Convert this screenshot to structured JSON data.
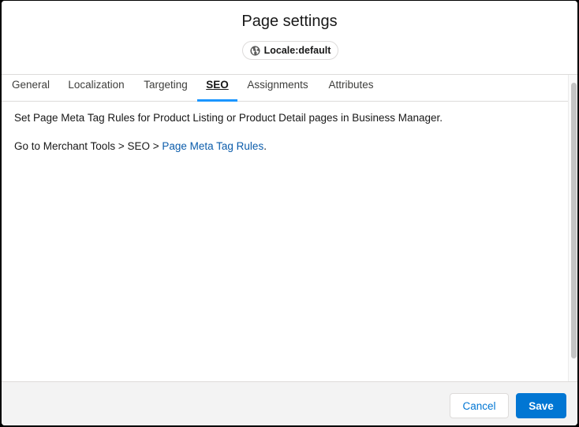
{
  "modal": {
    "title": "Page settings",
    "locale": {
      "icon": "globe-icon",
      "label": "Locale:default"
    }
  },
  "tabs": [
    {
      "label": "General",
      "active": false
    },
    {
      "label": "Localization",
      "active": false
    },
    {
      "label": "Targeting",
      "active": false
    },
    {
      "label": "SEO",
      "active": true
    },
    {
      "label": "Assignments",
      "active": false
    },
    {
      "label": "Attributes",
      "active": false
    }
  ],
  "content": {
    "line1": "Set Page Meta Tag Rules for Product Listing or Product Detail pages in Business Manager.",
    "line2_prefix": "Go to Merchant Tools > SEO > ",
    "line2_link": "Page Meta Tag Rules",
    "line2_suffix": "."
  },
  "footer": {
    "cancel_label": "Cancel",
    "save_label": "Save"
  },
  "colors": {
    "brand": "#0176d3",
    "link": "#0b5cab",
    "active_tab_indicator": "#1b96ff"
  }
}
